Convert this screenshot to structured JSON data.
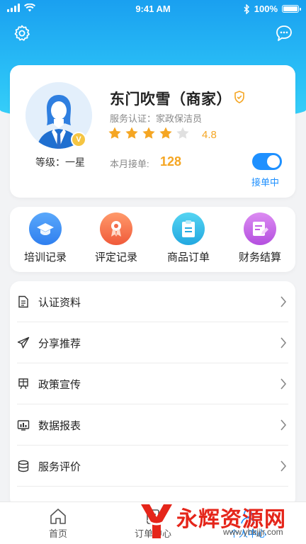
{
  "status_bar": {
    "time": "9:41 AM",
    "battery": "100%"
  },
  "profile": {
    "name": "东门吹雪（商家）",
    "certification": "服务认证：家政保洁员",
    "rating": "4.8",
    "stars_filled": 4,
    "stars_total": 5,
    "level": "等级：一星",
    "orders_label": "本月接单:",
    "orders_count": "128",
    "toggle_label": "接单中",
    "toggle_on": true,
    "medal_text": "V"
  },
  "quick_actions": [
    {
      "label": "培训记录",
      "icon": "graduation-cap-icon",
      "color": "#3a8ef6"
    },
    {
      "label": "评定记录",
      "icon": "badge-icon",
      "color": "#f36b4a"
    },
    {
      "label": "商品订单",
      "icon": "clipboard-icon",
      "color": "#2dbde8"
    },
    {
      "label": "财务结算",
      "icon": "note-edit-icon",
      "color": "#c45ee6"
    }
  ],
  "menu": [
    {
      "label": "认证资料",
      "icon": "document-icon"
    },
    {
      "label": "分享推荐",
      "icon": "paper-plane-icon"
    },
    {
      "label": "政策宣传",
      "icon": "policy-icon"
    },
    {
      "label": "数据报表",
      "icon": "report-icon"
    },
    {
      "label": "服务评价",
      "icon": "database-icon"
    }
  ],
  "tabs": [
    {
      "label": "首页",
      "icon": "home-icon"
    },
    {
      "label": "订单中心",
      "icon": "order-icon"
    },
    {
      "label": "个人中心",
      "icon": "user-icon"
    }
  ],
  "watermark": {
    "text": "永辉资源网",
    "url": "www.yhkjjjr.com"
  },
  "colors": {
    "primary": "#1e90ff",
    "header_start": "#1aa0f0",
    "accent": "#f5a623"
  }
}
